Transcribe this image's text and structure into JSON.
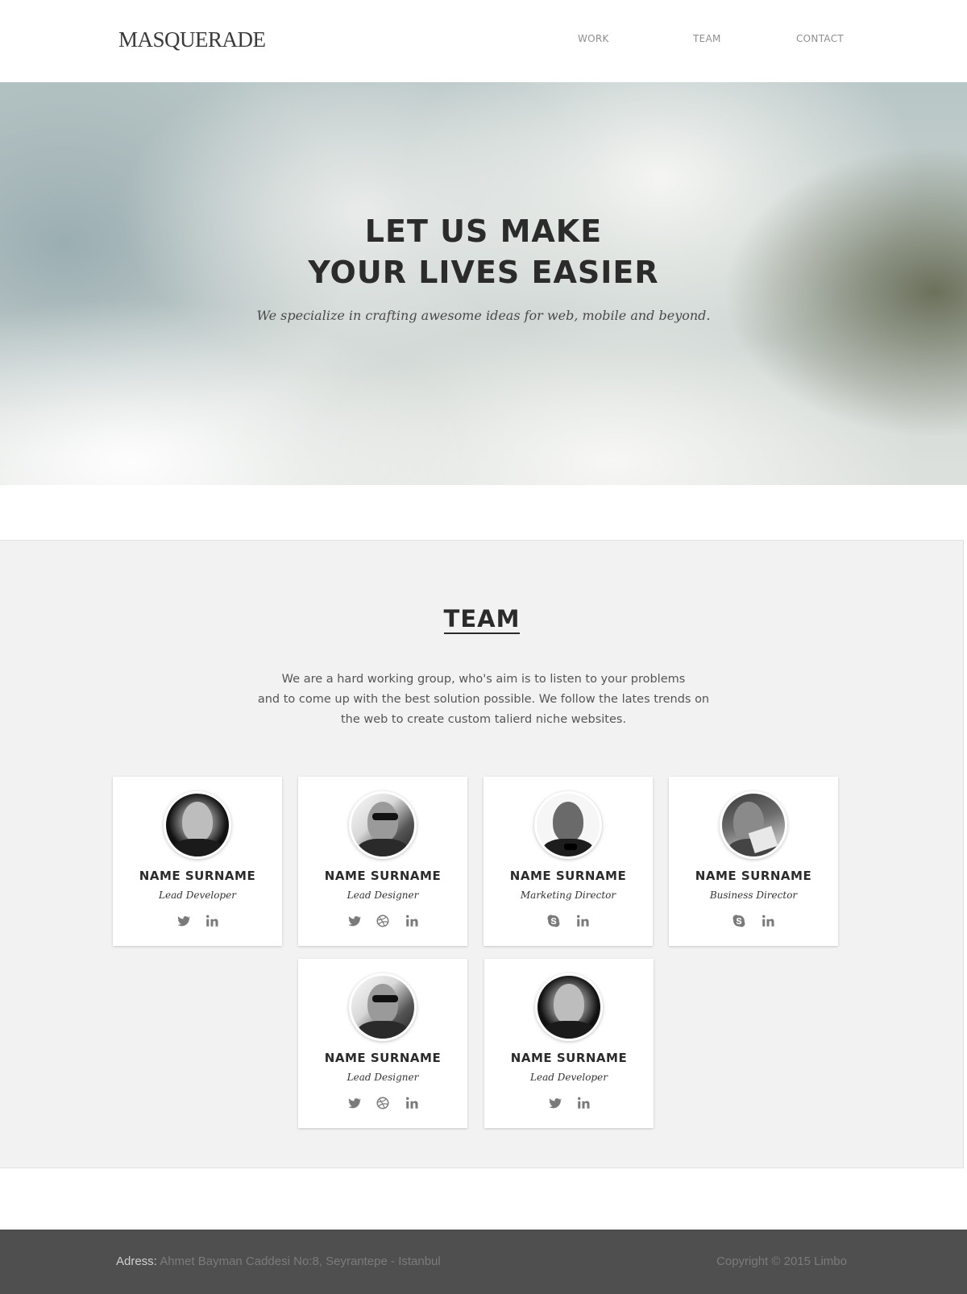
{
  "header": {
    "logo": "MASQUERADE",
    "nav": [
      "WORK",
      "TEAM",
      "CONTACT"
    ]
  },
  "hero": {
    "title_line1": "LET US MAKE",
    "title_line2": "YOUR LIVES EASIER",
    "subtitle": "We specialize in crafting awesome ideas for web, mobile and beyond."
  },
  "team": {
    "title": "TEAM",
    "description_lines": [
      "We are a hard working group, who's aim is to listen to your problems",
      "and to come up with the best solution possible. We follow the lates trends on",
      "the web to create custom talierd niche websites."
    ],
    "members": [
      {
        "name": "NAME SURNAME",
        "role": "Lead Developer",
        "avatar": "portrait-dark",
        "socials": [
          "twitter-icon",
          "linkedin-icon"
        ]
      },
      {
        "name": "NAME SURNAME",
        "role": "Lead Designer",
        "avatar": "portrait-sunglasses",
        "socials": [
          "twitter-icon",
          "dribbble-icon",
          "linkedin-icon"
        ]
      },
      {
        "name": "NAME SURNAME",
        "role": "Marketing Director",
        "avatar": "portrait-bowtie",
        "socials": [
          "skype-icon",
          "linkedin-icon"
        ]
      },
      {
        "name": "NAME SURNAME",
        "role": "Business Director",
        "avatar": "portrait-reading",
        "socials": [
          "skype-icon",
          "linkedin-icon"
        ]
      },
      {
        "name": "NAME SURNAME",
        "role": "Lead Designer",
        "avatar": "portrait-sunglasses",
        "socials": [
          "twitter-icon",
          "dribbble-icon",
          "linkedin-icon"
        ]
      },
      {
        "name": "NAME SURNAME",
        "role": "Lead Developer",
        "avatar": "portrait-dark",
        "socials": [
          "twitter-icon",
          "linkedin-icon"
        ]
      }
    ]
  },
  "footer": {
    "address_label": "Adress:",
    "address": "Ahmet Bayman Caddesi No:8, Seyrantepe - Istanbul",
    "copyright": "Copyright © 2015 Limbo"
  },
  "colors": {
    "text_dark": "#2b2b2b",
    "section_bg": "#f2f2f2",
    "footer_bg": "#4f4f4f",
    "icon_gray": "#7a7a7a"
  }
}
